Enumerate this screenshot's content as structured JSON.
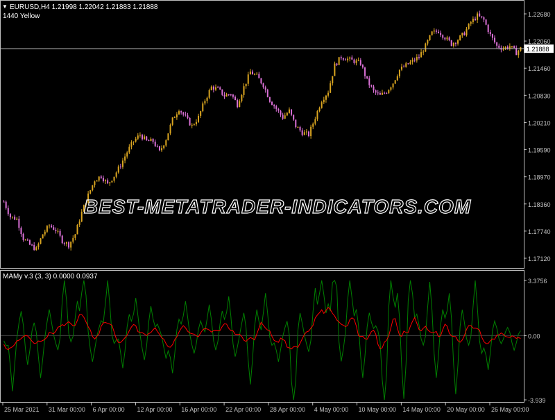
{
  "header": {
    "symbol_line": "EURUSD,H4  1.21998 1.22042 1.21883 1.21888",
    "indicator_name": "1440 Yellow",
    "dropdown_glyph": "▼"
  },
  "sub_header": {
    "indicator_line": "MAMy v.3 (3, 3) 0.0000 0.0937"
  },
  "watermark": "BEST-METATRADER-INDICATORS.COM",
  "colors": {
    "background": "#000000",
    "axis": "#c0c0c0",
    "bull_candle": "#daa520",
    "bear_candle": "#da70d6",
    "green_line": "#008000",
    "red_line": "#ff0000",
    "current_price_tag": "#ffffff"
  },
  "price_axis_labels": [
    "1.22680",
    "1.22060",
    "1.21460",
    "1.20830",
    "1.20210",
    "1.19590",
    "1.18970",
    "1.18360",
    "1.17740",
    "1.17120"
  ],
  "current_price": "1.21888",
  "oscillator_axis_labels": [
    "3.3756",
    "0.00",
    "-3.939"
  ],
  "time_axis_labels": [
    "25 Mar 2021",
    "31 Mar 00:00",
    "6 Apr 00:00",
    "12 Apr 00:00",
    "16 Apr 00:00",
    "22 Apr 00:00",
    "28 Apr 00:00",
    "4 May 00:00",
    "10 May 00:00",
    "14 May 00:00",
    "20 May 00:00",
    "26 May 00:00"
  ],
  "chart_data": {
    "type": "line",
    "price_ylim": [
      1.1685,
      1.2295
    ],
    "price_path": [
      [
        0,
        1.1835
      ],
      [
        3,
        1.18
      ],
      [
        6,
        1.1795
      ],
      [
        9,
        1.175
      ],
      [
        12,
        1.1735
      ],
      [
        15,
        1.1725
      ],
      [
        18,
        1.176
      ],
      [
        21,
        1.178
      ],
      [
        24,
        1.177
      ],
      [
        27,
        1.1745
      ],
      [
        30,
        1.1735
      ],
      [
        33,
        1.176
      ],
      [
        36,
        1.181
      ],
      [
        39,
        1.185
      ],
      [
        42,
        1.1885
      ],
      [
        45,
        1.1895
      ],
      [
        48,
        1.1875
      ],
      [
        51,
        1.1895
      ],
      [
        54,
        1.192
      ],
      [
        57,
        1.195
      ],
      [
        60,
        1.1975
      ],
      [
        63,
        1.199
      ],
      [
        66,
        1.1975
      ],
      [
        69,
        1.1975
      ],
      [
        72,
        1.195
      ],
      [
        75,
        1.198
      ],
      [
        78,
        1.2025
      ],
      [
        81,
        1.205
      ],
      [
        84,
        1.203
      ],
      [
        87,
        1.201
      ],
      [
        90,
        1.203
      ],
      [
        93,
        1.207
      ],
      [
        96,
        1.21
      ],
      [
        99,
        1.2095
      ],
      [
        102,
        1.208
      ],
      [
        105,
        1.2085
      ],
      [
        108,
        1.206
      ],
      [
        111,
        1.21
      ],
      [
        114,
        1.2135
      ],
      [
        117,
        1.2125
      ],
      [
        120,
        1.2105
      ],
      [
        123,
        1.207
      ],
      [
        126,
        1.205
      ],
      [
        129,
        1.203
      ],
      [
        132,
        1.2045
      ],
      [
        135,
        1.201
      ],
      [
        138,
        1.1995
      ],
      [
        141,
        1.199
      ],
      [
        144,
        1.203
      ],
      [
        147,
        1.207
      ],
      [
        150,
        1.209
      ],
      [
        153,
        1.215
      ],
      [
        156,
        1.217
      ],
      [
        159,
        1.2165
      ],
      [
        162,
        1.216
      ],
      [
        165,
        1.2155
      ],
      [
        168,
        1.2115
      ],
      [
        171,
        1.209
      ],
      [
        174,
        1.208
      ],
      [
        177,
        1.209
      ],
      [
        180,
        1.211
      ],
      [
        183,
        1.214
      ],
      [
        186,
        1.215
      ],
      [
        189,
        1.216
      ],
      [
        192,
        1.217
      ],
      [
        195,
        1.2195
      ],
      [
        198,
        1.2225
      ],
      [
        201,
        1.223
      ],
      [
        204,
        1.2215
      ],
      [
        207,
        1.22
      ],
      [
        210,
        1.221
      ],
      [
        213,
        1.2225
      ],
      [
        216,
        1.225
      ],
      [
        219,
        1.2265
      ],
      [
        222,
        1.2255
      ],
      [
        225,
        1.222
      ],
      [
        228,
        1.2195
      ],
      [
        231,
        1.219
      ],
      [
        234,
        1.2195
      ],
      [
        237,
        1.218
      ],
      [
        239,
        1.2189
      ]
    ],
    "oscillator_ylim": [
      -3.939,
      3.3756
    ],
    "oscillator_spikes": [
      [
        1,
        -0.6
      ],
      [
        4,
        -3.4
      ],
      [
        8,
        1.5
      ],
      [
        11,
        -1.8
      ],
      [
        14,
        0.8
      ],
      [
        17,
        -2.6
      ],
      [
        21,
        1.6
      ],
      [
        25,
        -0.9
      ],
      [
        28,
        4.1
      ],
      [
        31,
        -0.4
      ],
      [
        34,
        2.1
      ],
      [
        37,
        4.6
      ],
      [
        41,
        -1.6
      ],
      [
        45,
        0.9
      ],
      [
        48,
        3.6
      ],
      [
        51,
        -0.5
      ],
      [
        55,
        -2.0
      ],
      [
        58,
        1.3
      ],
      [
        61,
        2.3
      ],
      [
        65,
        -1.5
      ],
      [
        68,
        1.8
      ],
      [
        71,
        0.7
      ],
      [
        75,
        -1.4
      ],
      [
        78,
        -2.3
      ],
      [
        81,
        1.0
      ],
      [
        84,
        2.1
      ],
      [
        88,
        -1.1
      ],
      [
        91,
        0.9
      ],
      [
        95,
        1.9
      ],
      [
        98,
        -0.9
      ],
      [
        101,
        1.5
      ],
      [
        104,
        2.4
      ],
      [
        107,
        -1.3
      ],
      [
        111,
        1.4
      ],
      [
        114,
        -3.0
      ],
      [
        117,
        1.6
      ],
      [
        121,
        2.6
      ],
      [
        124,
        -0.6
      ],
      [
        127,
        -1.6
      ],
      [
        131,
        0.9
      ],
      [
        134,
        -5.4
      ],
      [
        137,
        1.4
      ],
      [
        141,
        -1.0
      ],
      [
        144,
        2.9
      ],
      [
        147,
        4.4
      ],
      [
        150,
        1.9
      ],
      [
        153,
        5.8
      ],
      [
        156,
        -1.6
      ],
      [
        160,
        4.1
      ],
      [
        163,
        1.6
      ],
      [
        166,
        -2.6
      ],
      [
        169,
        1.4
      ],
      [
        172,
        0.6
      ],
      [
        176,
        -5.1
      ],
      [
        179,
        4.0
      ],
      [
        182,
        2.6
      ],
      [
        185,
        -3.9
      ],
      [
        188,
        4.6
      ],
      [
        191,
        1.3
      ],
      [
        194,
        -0.6
      ],
      [
        197,
        3.3
      ],
      [
        200,
        -2.6
      ],
      [
        203,
        1.6
      ],
      [
        206,
        2.6
      ],
      [
        209,
        -3.6
      ],
      [
        212,
        1.6
      ],
      [
        215,
        -0.6
      ],
      [
        218,
        3.4
      ],
      [
        221,
        -1.1
      ],
      [
        224,
        -2.1
      ],
      [
        227,
        0.9
      ],
      [
        230,
        -0.5
      ],
      [
        233,
        0.5
      ],
      [
        236,
        -0.9
      ],
      [
        239,
        0.3
      ]
    ]
  }
}
